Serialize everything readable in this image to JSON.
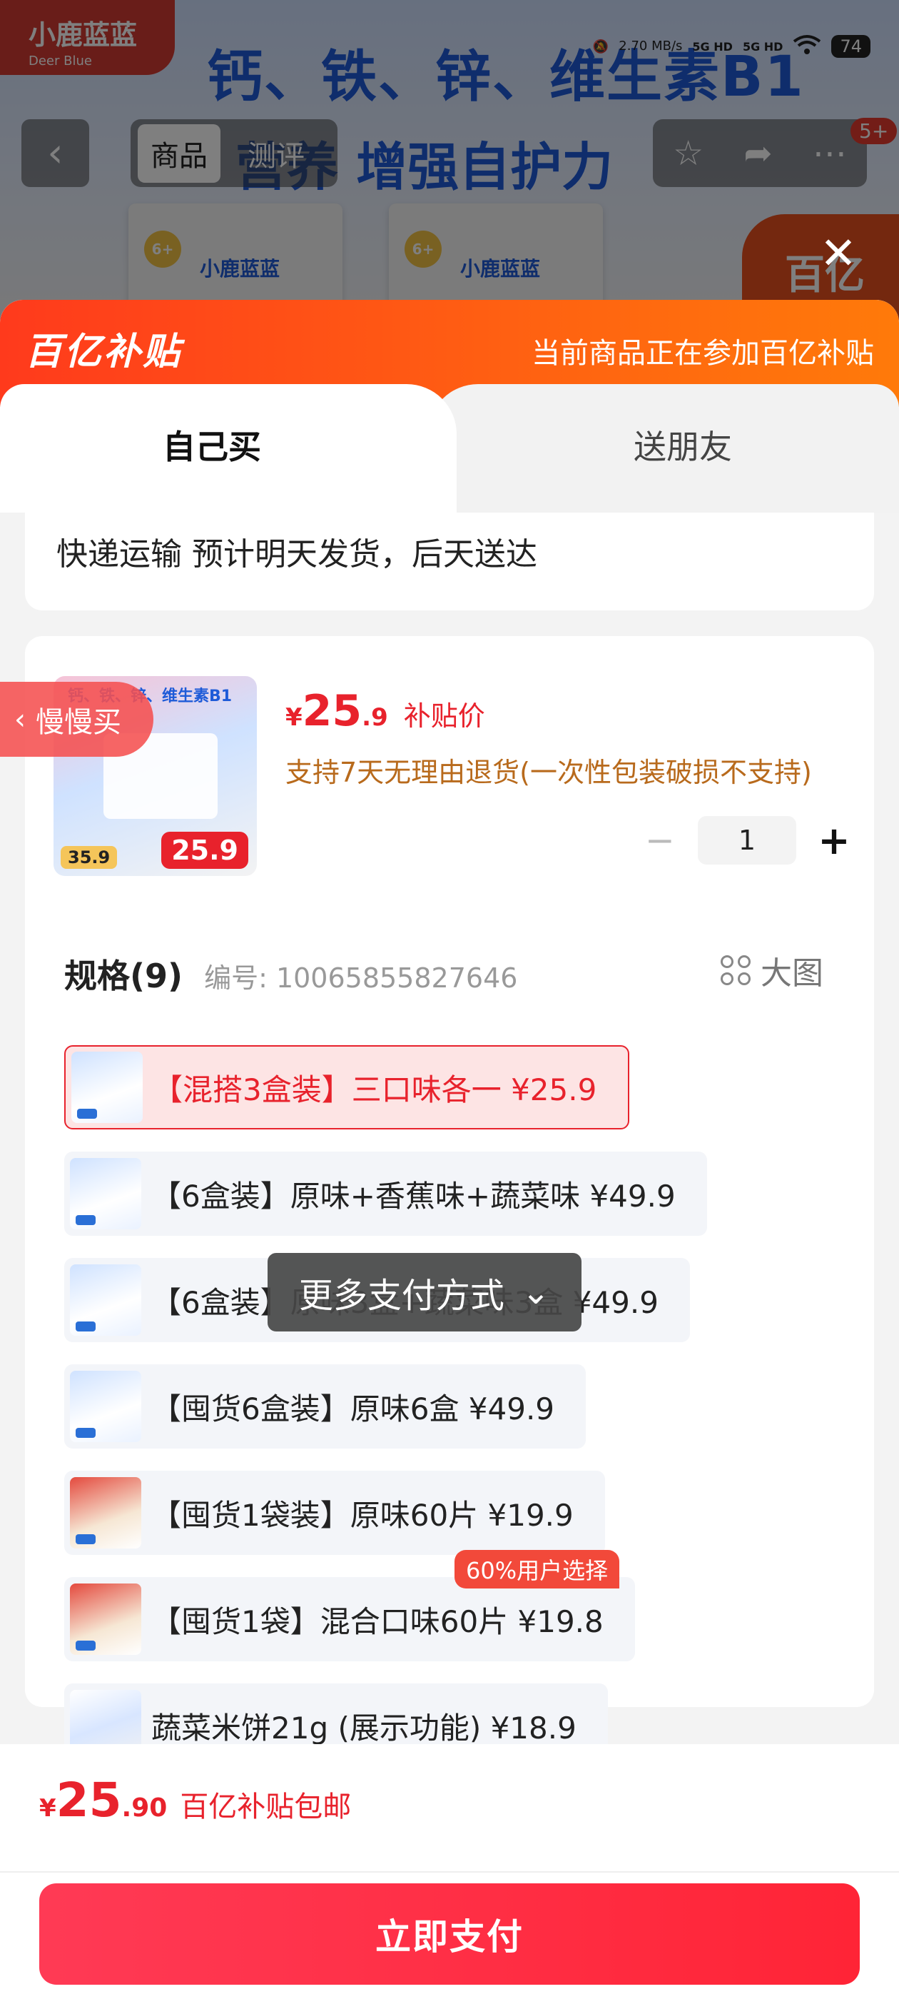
{
  "background": {
    "brand_logo": "小鹿蓝蓝",
    "brand_logo_sub": "Deer Blue",
    "headline_line1": "钙、铁、锌、维生素B1",
    "headline_line2": "营养 增强自护力",
    "box_label": "小鹿蓝蓝",
    "box_age": "6+",
    "corner_text": "百亿"
  },
  "status_bar": {
    "speed": "2.70 MB/s",
    "signal1": "5G HD",
    "signal2": "5G HD",
    "battery": "74"
  },
  "nav": {
    "back_icon": "chevron-left-icon",
    "tabs": [
      {
        "label": "商品",
        "active": true
      },
      {
        "label": "测评",
        "active": false
      }
    ],
    "badge": "5+"
  },
  "sheet": {
    "logo": "百亿补贴",
    "note": "当前商品正在参加百亿补贴",
    "tabs": [
      {
        "label": "自己买",
        "active": true
      },
      {
        "label": "送朋友",
        "active": false
      }
    ],
    "shipping": "快递运输 预计明天发货，后天送达"
  },
  "product": {
    "thumb_price": "25.9",
    "thumb_original": "35.9",
    "price_symbol": "¥",
    "price_int": "25",
    "price_dec": ".9",
    "price_label": "补贴价",
    "return_note": "支持7天无理由退货(一次性包装破损不支持)",
    "quantity": "1",
    "slow_buy": "慢慢买"
  },
  "spec": {
    "title": "规格(9)",
    "code": "编号: 10065855827646",
    "big_image": "大图",
    "options": [
      {
        "label": "【混搭3盒装】三口味各一  ¥25.9",
        "selected": true
      },
      {
        "label": "【6盒装】原味+香蕉味+蔬菜味  ¥49.9",
        "selected": false
      },
      {
        "label": "【6盒装】原味3盒+蔬菜味3盒  ¥49.9",
        "selected": false
      },
      {
        "label": "【囤货6盒装】原味6盒  ¥49.9",
        "selected": false
      },
      {
        "label": "【囤货1袋装】原味60片  ¥19.9",
        "selected": false
      },
      {
        "label": "【囤货1袋】混合口味60片  ¥19.8",
        "selected": false
      },
      {
        "label": "蔬菜米饼21g (展示功能)  ¥18.9",
        "selected": false
      }
    ],
    "popular_badge": "60%用户选择"
  },
  "more_pay": "更多支付方式",
  "footer": {
    "price_symbol": "¥",
    "price_int": "25",
    "price_dec": ".90",
    "label": "百亿补贴包邮",
    "pay_button": "立即支付"
  },
  "colors": {
    "accent_red": "#e8222c",
    "subsidy_orange": "#ff5f12",
    "return_note": "#b86a1c"
  }
}
